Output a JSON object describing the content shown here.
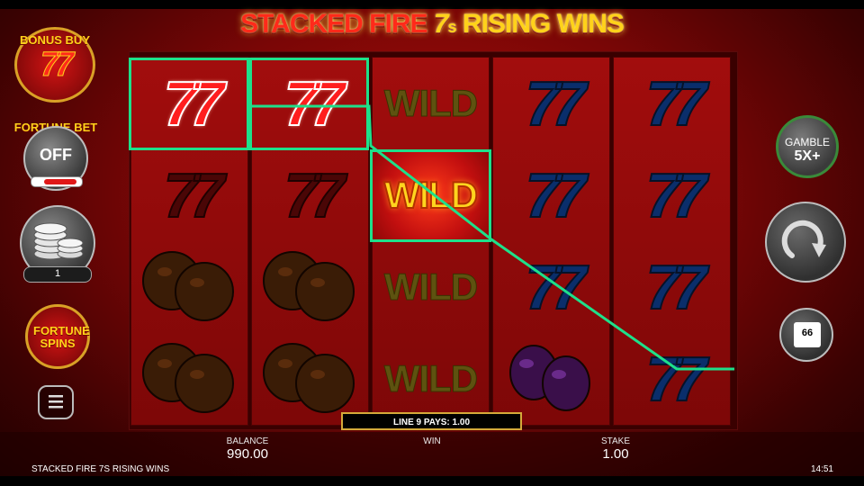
{
  "game": {
    "title_stacked": "STACKED FIRE",
    "title_seven": "7",
    "title_s": "s",
    "title_rising": "RISING WINS",
    "footer_name": "STACKED FIRE 7S RISING WINS",
    "clock": "14:51"
  },
  "left_panel": {
    "bonus_buy_label": "BONUS BUY",
    "bonus_buy_symbol": "77",
    "fortune_bet_label": "FORTUNE BET",
    "fortune_bet_state": "OFF",
    "coins_value": "1",
    "fortune_spins_label": "FORTUNE SPINS",
    "menu_icon": "hamburger-menu-icon"
  },
  "right_panel": {
    "gamble_label": "GAMBLE",
    "gamble_multiplier": "5X+",
    "spin_icon": "circular-arrow-icon",
    "autoplay_count": "66"
  },
  "reels": {
    "symbols": [
      [
        "77",
        "77",
        "orange",
        "orange"
      ],
      [
        "77",
        "77",
        "orange",
        "orange"
      ],
      [
        "WILD",
        "WILD",
        "WILD",
        "WILD"
      ],
      [
        "77",
        "77",
        "77",
        "plum"
      ],
      [
        "77",
        "77",
        "77",
        "77"
      ]
    ],
    "wild_text": "WILD",
    "seven_text": "77"
  },
  "win_line": "LINE 9 PAYS: 1.00",
  "meters": {
    "balance_label": "BALANCE",
    "balance_value": "990.00",
    "win_label": "WIN",
    "stake_label": "STAKE",
    "stake_value": "1.00"
  }
}
